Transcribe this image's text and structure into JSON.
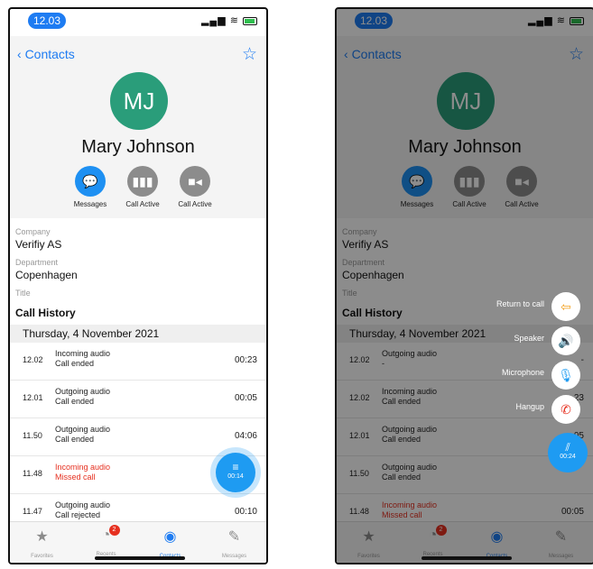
{
  "status": {
    "time": "12.03"
  },
  "contact": {
    "back_label": "Contacts",
    "initials": "MJ",
    "name": "Mary Johnson",
    "actions": [
      "Messages",
      "Call Active",
      "Call Active"
    ],
    "company_label": "Company",
    "company": "Verifiy AS",
    "department_label": "Department",
    "department": "Copenhagen",
    "title_label": "Title"
  },
  "history": {
    "heading": "Call History",
    "date": "Thursday, 4 November 2021",
    "left_rows": [
      {
        "time": "12.02",
        "type": "Incoming audio",
        "status": "Call ended",
        "duration": "00:23",
        "missed": false
      },
      {
        "time": "12.01",
        "type": "Outgoing audio",
        "status": "Call ended",
        "duration": "00:05",
        "missed": false
      },
      {
        "time": "11.50",
        "type": "Outgoing audio",
        "status": "Call ended",
        "duration": "04:06",
        "missed": false
      },
      {
        "time": "11.48",
        "type": "Incoming audio",
        "status": "Missed call",
        "duration": "",
        "missed": true
      },
      {
        "time": "11.47",
        "type": "Outgoing audio",
        "status": "Call rejected",
        "duration": "00:10",
        "missed": false
      }
    ],
    "right_rows": [
      {
        "time": "12.02",
        "type": "Outgoing audio",
        "status": "-",
        "duration": "-",
        "missed": false
      },
      {
        "time": "12.02",
        "type": "Incoming audio",
        "status": "Call ended",
        "duration": "23",
        "missed": false
      },
      {
        "time": "12.01",
        "type": "Outgoing audio",
        "status": "Call ended",
        "duration": "05",
        "missed": false
      },
      {
        "time": "11.50",
        "type": "Outgoing audio",
        "status": "Call ended",
        "duration": "",
        "missed": false
      },
      {
        "time": "11.48",
        "type": "Incoming audio",
        "status": "Missed call",
        "duration": "00:05",
        "missed": true
      }
    ]
  },
  "fab_left": {
    "timer": "00:14"
  },
  "fab_right": {
    "timer": "00:24"
  },
  "call_menu": [
    "Return to call",
    "Speaker",
    "Microphone",
    "Hangup"
  ],
  "tabs": {
    "favorites": "Favorites",
    "recents": "Recents",
    "contacts": "Contacts",
    "messages": "Messages",
    "badge": "2"
  },
  "colors": {
    "accent": "#1e7cf2",
    "missed": "#e63020",
    "avatar": "#2a9d7a"
  }
}
